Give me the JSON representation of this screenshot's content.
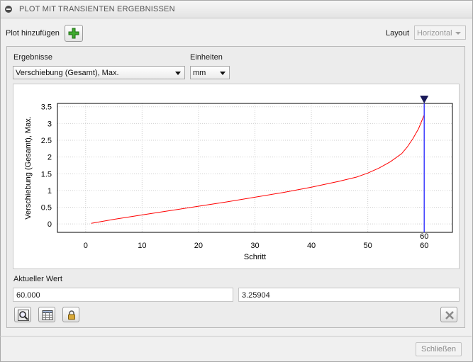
{
  "window": {
    "title": "PLOT MIT TRANSIENTEN ERGEBNISSEN"
  },
  "toolbar": {
    "add_plot_label": "Plot hinzufügen",
    "layout_label": "Layout",
    "layout_value": "Horizontal"
  },
  "results": {
    "results_label": "Ergebnisse",
    "results_value": "Verschiebung (Gesamt), Max.",
    "units_label": "Einheiten",
    "units_value": "mm"
  },
  "chart_data": {
    "type": "line",
    "xlabel": "Schritt",
    "ylabel": "Verschiebung (Gesamt), Max.",
    "xlim": [
      -5,
      65
    ],
    "ylim": [
      -0.25,
      3.6
    ],
    "xticks": [
      0,
      10,
      20,
      30,
      40,
      50,
      60
    ],
    "yticks": [
      0,
      0.5,
      1,
      1.5,
      2,
      2.5,
      3,
      3.5
    ],
    "ytick_labels": [
      "0",
      "0.5",
      "1",
      "1.5",
      "2",
      "2.5",
      "3",
      "3.5"
    ],
    "grid": true,
    "series": [
      {
        "color": "#ff0000",
        "x": [
          1,
          5,
          10,
          15,
          20,
          25,
          30,
          35,
          40,
          45,
          48,
          50,
          52,
          54,
          56,
          57,
          58,
          59,
          60
        ],
        "y": [
          0.02,
          0.14,
          0.27,
          0.4,
          0.53,
          0.66,
          0.8,
          0.94,
          1.1,
          1.28,
          1.4,
          1.52,
          1.67,
          1.86,
          2.1,
          2.3,
          2.55,
          2.85,
          3.25904
        ]
      }
    ],
    "marker": {
      "x": 60,
      "label": "60",
      "color": "#4040ff"
    }
  },
  "current_value": {
    "label": "Aktueller Wert",
    "x": "60.000",
    "y": "3.25904"
  },
  "footer": {
    "close_label": "Schließen"
  }
}
